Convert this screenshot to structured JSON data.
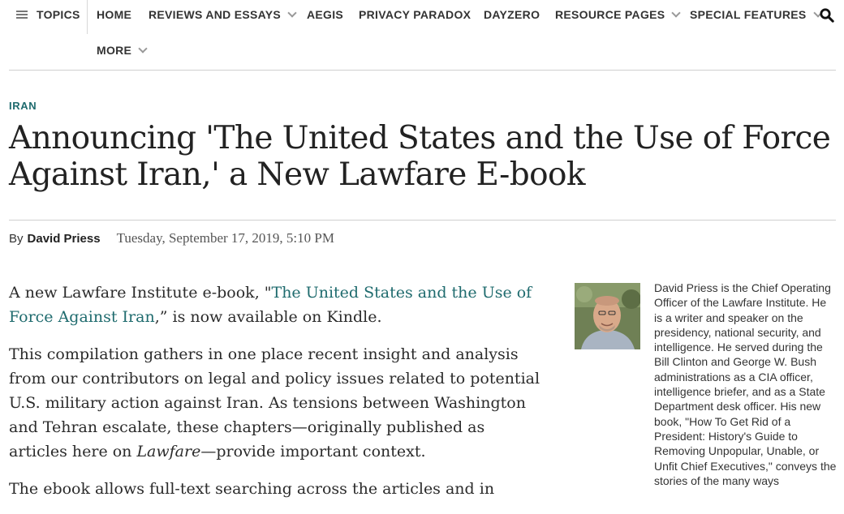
{
  "nav": {
    "topics_label": "TOPICS",
    "items": [
      {
        "label": "HOME"
      },
      {
        "label": "REVIEWS AND ESSAYS"
      },
      {
        "label": "AEGIS"
      },
      {
        "label": "PRIVACY PARADOX"
      },
      {
        "label": "DAYZERO"
      },
      {
        "label": "RESOURCE PAGES"
      },
      {
        "label": "SPECIAL FEATURES"
      },
      {
        "label": "MORE"
      }
    ],
    "search_icon": "search-icon"
  },
  "article": {
    "category": "IRAN",
    "title": "Announcing 'The United States and the Use of Force Against Iran,' a New Lawfare E-book",
    "byline_prefix": "By",
    "author": "David Priess",
    "date": "Tuesday, September 17, 2019, 5:10 PM",
    "paragraphs": [
      {
        "pre": "A new Lawfare Institute e-book, \"",
        "link": "The United States and the Use of Force Against Iran",
        "post": ",” is now available on Kindle."
      },
      {
        "pre": "This compilation gathers in one place recent insight and analysis from our contributors on legal and policy issues related to potential U.S. military action against Iran. As tensions between Washington and Tehran escalate, these chapters—originally published as articles here on ",
        "em": "Lawfare",
        "post": "—provide important context."
      },
      {
        "text": "The ebook allows full-text searching across the articles and in"
      }
    ]
  },
  "author_bio": {
    "avatar_alt": "avatar",
    "text": "David Priess is the Chief Operating Officer of the Lawfare Institute. He is a writer and speaker on the presidency, national security, and intelligence. He served during the Bill Clinton and George W. Bush administrations as a CIA officer, intelligence briefer, and as a State Department desk officer. His new book, \"How To Get Rid of a President: History's Guide to Removing Unpopular, Unable, or Unfit Chief Executives,\" conveys the stories of the many ways"
  },
  "colors": {
    "accent_teal": "#1f6b6e",
    "text": "#2b2b2b"
  }
}
